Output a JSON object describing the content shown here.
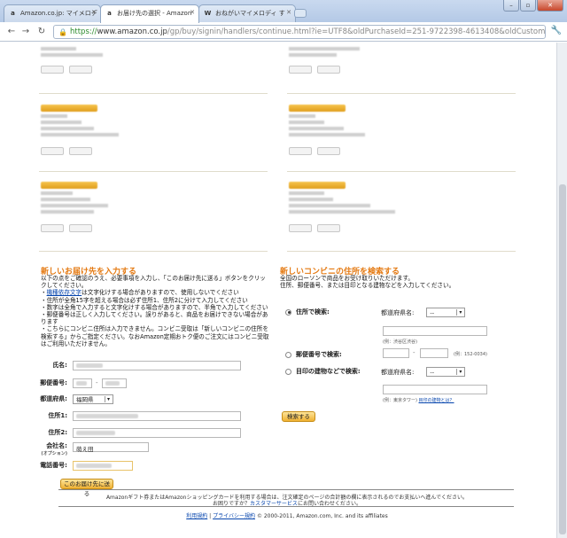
{
  "browser": {
    "tabs": [
      {
        "label": "Amazon.co.jp: マイメロデ",
        "favicon": "a"
      },
      {
        "label": "お届け先の選択 - Amazon",
        "favicon": "a"
      },
      {
        "label": "おねがいマイメロディ す",
        "favicon": "W"
      }
    ],
    "url_https": "https://",
    "url_host": "www.amazon.co.jp",
    "url_path": "/gp/buy/signin/handlers/continue.html?ie=UTF8&oldPurchaseId=251-9722398-4613408&oldCustomerId"
  },
  "new_address": {
    "title": "新しいお届け先を入力する",
    "intro": [
      "以下の点をご確認のうえ、必要事項を入力し、「このお届け先に送る」ボタンをクリックしてください。",
      "・機種依存文字は文字化けする場合がありますので、使用しないでください",
      "・住所が全角15字を超える場合は必ず住所1、住所2に分けて入力してください",
      "・数字は全角で入力すると文字化けする場合がありますので、半角で入力してください",
      "・郵便番号は正しく入力してください。誤りがあると、商品をお届けできない場合があります",
      "・こちらにコンビニ住所は入力できません。コンビニ受取は「新しいコンビニの住所を検索する」からご指定ください。なおAmazon定期おトク便のご注文にはコンビニ受取はご利用いただけません。"
    ],
    "intro_link": "機種依存文字",
    "labels": {
      "name": "氏名:",
      "zip": "郵便番号:",
      "prefecture": "都道府県:",
      "addr1": "住所1:",
      "addr2": "住所2:",
      "company": "会社名:",
      "company_note": "(オプション)",
      "phone": "電話番号:"
    },
    "prefecture_value": "福岡県",
    "company_value": "萌え田",
    "submit": "このお届け先に送る"
  },
  "convenience": {
    "title": "新しいコンビニの住所を検索する",
    "intro": [
      "全国のローソンで商品をお受け取りいただけます。",
      "住所、郵便番号、または目印となる建物などを入力してください。"
    ],
    "by_address": "住所で検索:",
    "by_zip": "郵便番号で検索:",
    "by_building": "目印の建物などで検索:",
    "pref_label": "都道府県名:",
    "pref_value": "--",
    "addr_example": "(例：渋谷区渋谷)",
    "zip_example": "(例：152-0034)",
    "building_example": "(例：東京タワー)",
    "building_link": "目印の建物とは？",
    "search_button": "検索する"
  },
  "footer": {
    "line1": "Amazonギフト券またはAmazonショッピングカードを利用する場合は、注文確定のページの合計額の欄に表示されるのでお支払いへ進んでください。",
    "line2a": "お困りですか？",
    "line2_link": "カスタマーサービス",
    "line2b": "にお問い合わせください。",
    "terms": "利用規約",
    "privacy": "プライバシー規約",
    "copyright": "© 2000-2011, Amazon.com, Inc. and its affiliates"
  },
  "colors": {
    "accent": "#e47911",
    "button": "#f0b132",
    "link": "#0645ad"
  }
}
